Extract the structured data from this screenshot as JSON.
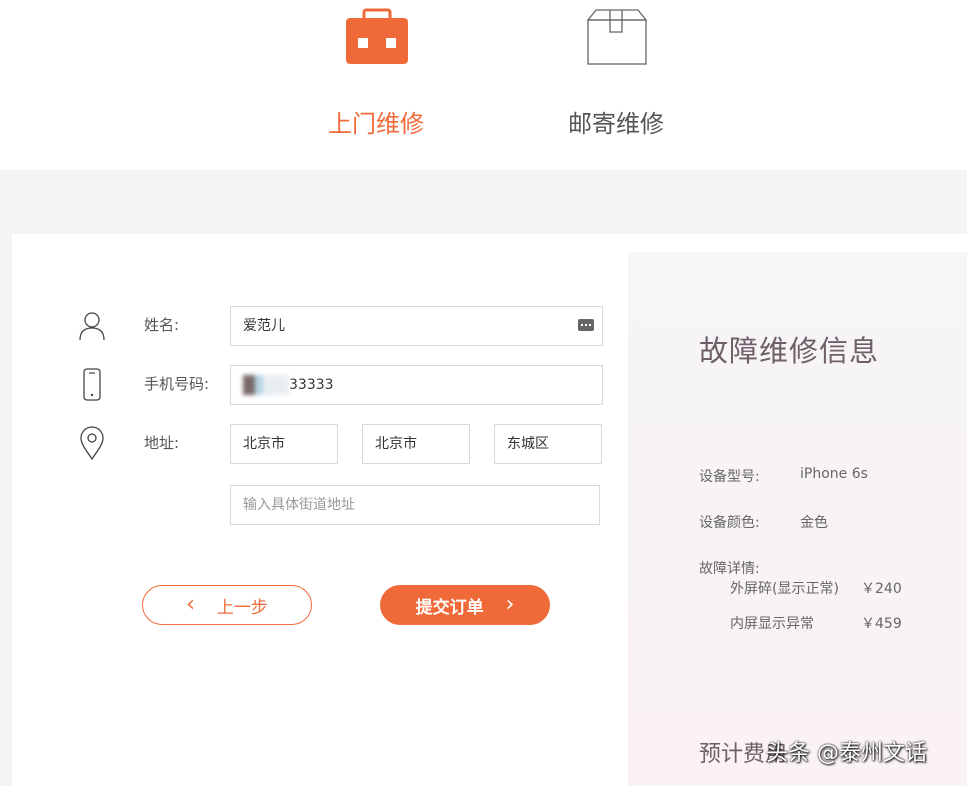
{
  "service_tabs": {
    "onsite_label": "上门维修",
    "mail_label": "邮寄维修",
    "active_color": "#f06a39"
  },
  "form": {
    "name_label": "姓名:",
    "name_value": "爱范儿",
    "phone_label": "手机号码:",
    "phone_value_visible": "33333",
    "address_label": "地址:",
    "province": "北京市",
    "city": "北京市",
    "district": "东城区",
    "street_placeholder": "输入具体街道地址"
  },
  "buttons": {
    "prev_label": "上一步",
    "submit_label": "提交订单"
  },
  "info_panel": {
    "title": "故障维修信息",
    "model_key": "设备型号:",
    "model_value": "iPhone 6s",
    "color_key": "设备颜色:",
    "color_value": "金色",
    "fault_key": "故障详情:",
    "faults": [
      {
        "name": "外屏碎(显示正常)",
        "price": "￥240"
      },
      {
        "name": "内屏显示异常",
        "price": "￥459"
      }
    ],
    "fee_label": "预计费用"
  },
  "watermark": "头条 @泰州文话"
}
